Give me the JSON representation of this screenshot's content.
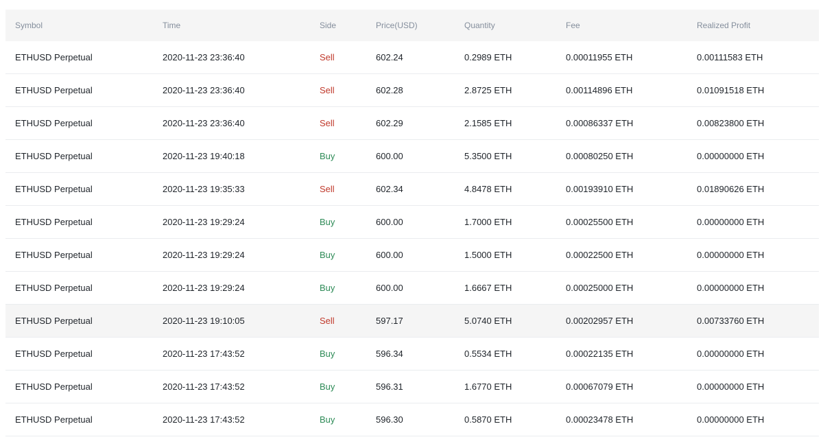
{
  "colors": {
    "sell": "#c0392b",
    "buy": "#2e8b57",
    "header_text": "#848e9c",
    "header_bg": "#f5f5f5",
    "row_border": "#eaecef",
    "hover_row_bg": "#f5f5f5"
  },
  "table": {
    "headers": {
      "symbol": "Symbol",
      "time": "Time",
      "side": "Side",
      "price": "Price(USD)",
      "quantity": "Quantity",
      "fee": "Fee",
      "realized_profit": "Realized Profit"
    },
    "highlighted_row": 8,
    "rows": [
      {
        "symbol": "ETHUSD Perpetual",
        "time": "2020-11-23 23:36:40",
        "side": "Sell",
        "price": "602.24",
        "quantity": "0.2989 ETH",
        "fee": "0.00011955 ETH",
        "realized_profit": "0.00111583 ETH"
      },
      {
        "symbol": "ETHUSD Perpetual",
        "time": "2020-11-23 23:36:40",
        "side": "Sell",
        "price": "602.28",
        "quantity": "2.8725 ETH",
        "fee": "0.00114896 ETH",
        "realized_profit": "0.01091518 ETH"
      },
      {
        "symbol": "ETHUSD Perpetual",
        "time": "2020-11-23 23:36:40",
        "side": "Sell",
        "price": "602.29",
        "quantity": "2.1585 ETH",
        "fee": "0.00086337 ETH",
        "realized_profit": "0.00823800 ETH"
      },
      {
        "symbol": "ETHUSD Perpetual",
        "time": "2020-11-23 19:40:18",
        "side": "Buy",
        "price": "600.00",
        "quantity": "5.3500 ETH",
        "fee": "0.00080250 ETH",
        "realized_profit": "0.00000000 ETH"
      },
      {
        "symbol": "ETHUSD Perpetual",
        "time": "2020-11-23 19:35:33",
        "side": "Sell",
        "price": "602.34",
        "quantity": "4.8478 ETH",
        "fee": "0.00193910 ETH",
        "realized_profit": "0.01890626 ETH"
      },
      {
        "symbol": "ETHUSD Perpetual",
        "time": "2020-11-23 19:29:24",
        "side": "Buy",
        "price": "600.00",
        "quantity": "1.7000 ETH",
        "fee": "0.00025500 ETH",
        "realized_profit": "0.00000000 ETH"
      },
      {
        "symbol": "ETHUSD Perpetual",
        "time": "2020-11-23 19:29:24",
        "side": "Buy",
        "price": "600.00",
        "quantity": "1.5000 ETH",
        "fee": "0.00022500 ETH",
        "realized_profit": "0.00000000 ETH"
      },
      {
        "symbol": "ETHUSD Perpetual",
        "time": "2020-11-23 19:29:24",
        "side": "Buy",
        "price": "600.00",
        "quantity": "1.6667 ETH",
        "fee": "0.00025000 ETH",
        "realized_profit": "0.00000000 ETH"
      },
      {
        "symbol": "ETHUSD Perpetual",
        "time": "2020-11-23 19:10:05",
        "side": "Sell",
        "price": "597.17",
        "quantity": "5.0740 ETH",
        "fee": "0.00202957 ETH",
        "realized_profit": "0.00733760 ETH"
      },
      {
        "symbol": "ETHUSD Perpetual",
        "time": "2020-11-23 17:43:52",
        "side": "Buy",
        "price": "596.34",
        "quantity": "0.5534 ETH",
        "fee": "0.00022135 ETH",
        "realized_profit": "0.00000000 ETH"
      },
      {
        "symbol": "ETHUSD Perpetual",
        "time": "2020-11-23 17:43:52",
        "side": "Buy",
        "price": "596.31",
        "quantity": "1.6770 ETH",
        "fee": "0.00067079 ETH",
        "realized_profit": "0.00000000 ETH"
      },
      {
        "symbol": "ETHUSD Perpetual",
        "time": "2020-11-23 17:43:52",
        "side": "Buy",
        "price": "596.30",
        "quantity": "0.5870 ETH",
        "fee": "0.00023478 ETH",
        "realized_profit": "0.00000000 ETH"
      }
    ]
  }
}
